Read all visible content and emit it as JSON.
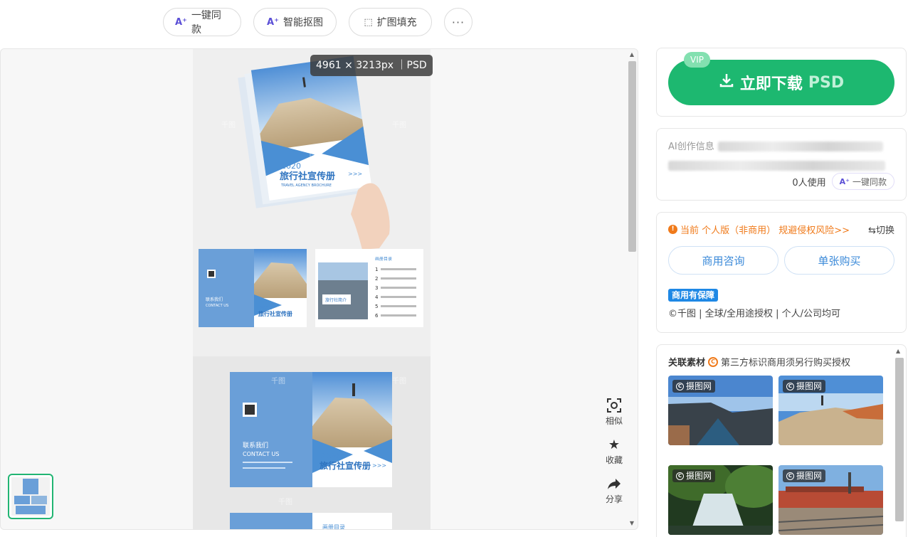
{
  "toolbar": {
    "one_click_same": "一键同款",
    "smart_cutout": "智能抠图",
    "expand_fill": "扩图填充",
    "more": "···"
  },
  "preview": {
    "dimensions": "4961 × 3213px ｜PSD",
    "brochure_year": "2020",
    "brochure_title": "旅行社宣传册",
    "brochure_subtitle": "TRAVEL AGENCY BROCHURE",
    "brochure_arrows": ">>>",
    "contact_cn": "联系我们",
    "contact_en": "CONTACT US",
    "intro_title": "旅行社简介",
    "toc_title": "画册目录",
    "watermark": "千图",
    "toc_numbers": [
      "1",
      "2",
      "3",
      "4",
      "5",
      "6"
    ]
  },
  "side_tools": [
    {
      "label": "相似",
      "icon": "scan-icon"
    },
    {
      "label": "收藏",
      "icon": "star-icon"
    },
    {
      "label": "分享",
      "icon": "share-icon"
    }
  ],
  "download": {
    "vip": "VIP",
    "label": "立即下载",
    "format": "PSD"
  },
  "ai_info": {
    "title": "AI创作信息",
    "usage": "0人使用",
    "same_btn": "一键同款"
  },
  "license": {
    "current": "当前 个人版（非商用） 规避侵权风险>>",
    "switch": "⇆切换",
    "commercial_consult": "商用咨询",
    "single_buy": "单张购买",
    "guarantee_badge": "商用有保障",
    "guarantee_text": "©千图 | 全球/全用途授权 | 个人/公司均可"
  },
  "related": {
    "title": "关联素材",
    "note": "第三方标识商用须另行购买授权",
    "badge": "摄图网",
    "items": [
      "canal-town",
      "desert-hiker",
      "waterfall",
      "railway-station"
    ]
  },
  "colors": {
    "primary_green": "#1db870",
    "orange": "#f07a1a",
    "blue": "#3b8ad9",
    "brochure_blue": "#4a8fd4"
  }
}
